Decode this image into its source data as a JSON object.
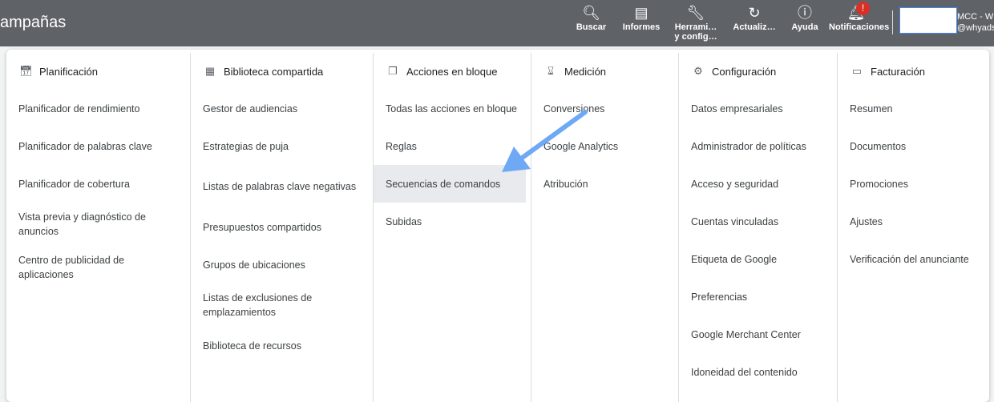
{
  "header": {
    "title": "ampañas",
    "buttons": [
      {
        "label": "Buscar",
        "icon": "search-icon"
      },
      {
        "label": "Informes",
        "icon": "bar-chart-icon"
      },
      {
        "label": "Herrami… y config…",
        "icon": "wrench-icon"
      },
      {
        "label": "Actualiz…",
        "icon": "refresh-icon"
      },
      {
        "label": "Ayuda",
        "icon": "help-icon"
      },
      {
        "label": "Notificaciones",
        "icon": "bell-icon",
        "badge": "!"
      }
    ],
    "account": {
      "line1": "MCC - W",
      "line2": "@whyadsm"
    }
  },
  "colors": {
    "topbar": "#5f6368",
    "selected": "#e8eaed",
    "arrow": "#6fa8f5",
    "badge": "#d93025"
  },
  "columns": [
    {
      "title": "Planificación",
      "icon": "calendar-icon",
      "items": [
        "Planificador de rendimiento",
        "Planificador de palabras clave",
        "Planificador de cobertura",
        "Vista previa y diagnóstico de anuncios",
        "Centro de publicidad de aplicaciones"
      ]
    },
    {
      "title": "Biblioteca compartida",
      "icon": "library-icon",
      "items": [
        "Gestor de audiencias",
        "Estrategias de puja",
        "Listas de palabras clave negativas",
        "Presupuestos compartidos",
        "Grupos de ubicaciones",
        "Listas de exclusiones de emplazamientos",
        "Biblioteca de recursos"
      ]
    },
    {
      "title": "Acciones en bloque",
      "icon": "copy-icon",
      "items": [
        "Todas las acciones en bloque",
        "Reglas",
        "Secuencias de comandos",
        "Subidas"
      ],
      "selected": "Secuencias de comandos"
    },
    {
      "title": "Medición",
      "icon": "hourglass-icon",
      "items": [
        "Conversiones",
        "Google Analytics",
        "Atribución"
      ]
    },
    {
      "title": "Configuración",
      "icon": "settings-icon",
      "items": [
        "Datos empresariales",
        "Administrador de políticas",
        "Acceso y seguridad",
        "Cuentas vinculadas",
        "Etiqueta de Google",
        "Preferencias",
        "Google Merchant Center",
        "Idoneidad del contenido"
      ]
    },
    {
      "title": "Facturación",
      "icon": "credit-card-icon",
      "items": [
        "Resumen",
        "Documentos",
        "Promociones",
        "Ajustes",
        "Verificación del anunciante"
      ]
    }
  ]
}
